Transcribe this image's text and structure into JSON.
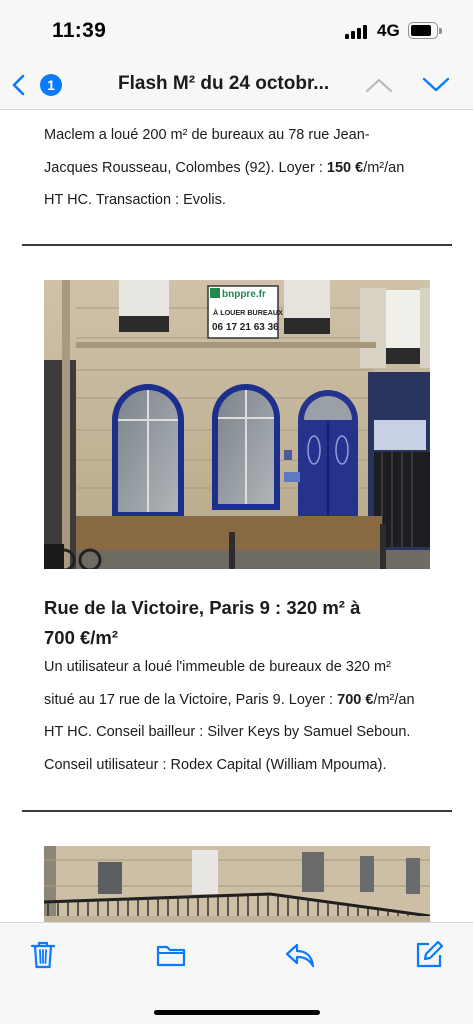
{
  "status_bar": {
    "time": "11:39",
    "network": "4G",
    "battery_level": 0.85
  },
  "nav": {
    "back_icon": "chevron-left-icon",
    "unread_count": "1",
    "title": "Flash M² du 24 octobr...",
    "up_icon": "chevron-up-icon",
    "down_icon": "chevron-down-icon",
    "accent_color": "#0a7aff"
  },
  "article1": {
    "text_line1": "Maclem a loué 200 m² de bureaux au 78 rue Jean-",
    "text_line2_pre": "Jacques Rousseau, Colombes (92). Loyer : ",
    "text_line2_bold": "150 €",
    "text_line2_post": "/m²/an",
    "text_line3": "HT HC. Transaction : Evolis."
  },
  "article2": {
    "sign_line1": "bnppre.fr",
    "sign_line2": "À LOUER BUREAUX",
    "sign_line3": "06 17 21 63 36",
    "title_line1": "Rue de la Victoire, Paris 9 : 320 m² à",
    "title_line2": "700 €/m²",
    "body_line1": "Un utilisateur a loué l'immeuble de bureaux de 320 m²",
    "body_line2_pre": "situé au 17 rue de la Victoire, Paris 9. Loyer : ",
    "body_line2_bold": "700 €",
    "body_line2_post": "/m²/an",
    "body_line3": "HT HC. Conseil bailleur : Silver Keys by Samuel Seboun.",
    "body_line4": "Conseil utilisateur : Rodex Capital (William Mpouma)."
  },
  "toolbar": {
    "trash_icon": "trash-icon",
    "folder_icon": "folder-icon",
    "reply_icon": "reply-icon",
    "compose_icon": "compose-icon"
  }
}
